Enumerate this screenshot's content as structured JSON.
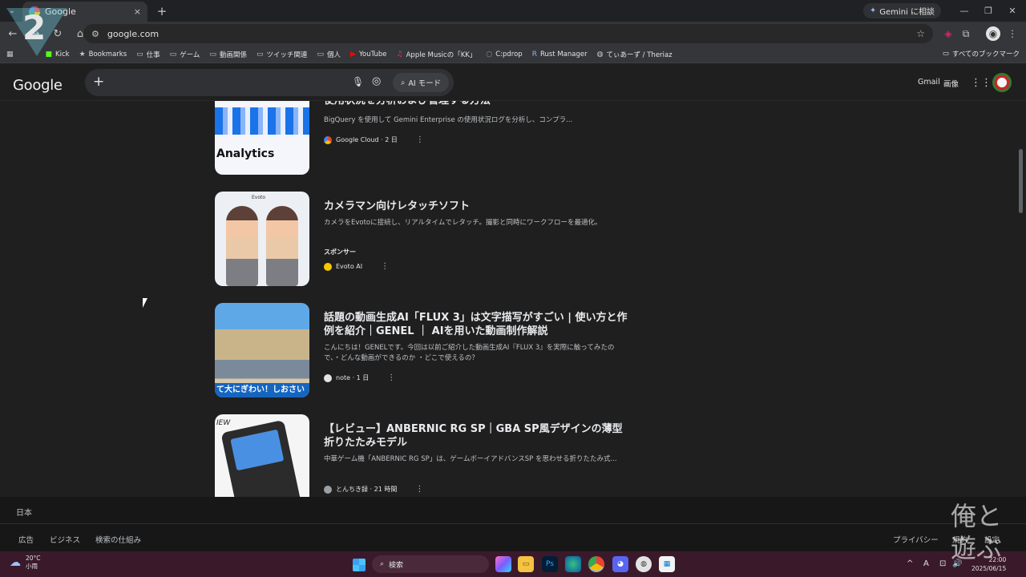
{
  "browser": {
    "tab_title": "Google",
    "tab_close": "×",
    "new_tab": "+",
    "gemini_label": "Gemini に相談",
    "url": "google.com",
    "bookmarks": [
      {
        "icon": "kick-icon",
        "label": "Kick"
      },
      {
        "icon": "star-icon",
        "label": "Bookmarks"
      },
      {
        "icon": "folder-icon",
        "label": "仕事"
      },
      {
        "icon": "folder-icon",
        "label": "ゲーム"
      },
      {
        "icon": "folder-icon",
        "label": "動画関係"
      },
      {
        "icon": "folder-icon",
        "label": "ツイッチ関連"
      },
      {
        "icon": "folder-icon",
        "label": "個人"
      },
      {
        "icon": "youtube-icon",
        "label": "YouTube"
      },
      {
        "icon": "apple-music-icon",
        "label": "Apple Musicの「KK」"
      },
      {
        "icon": "cpdrop-icon",
        "label": "C:pdrop"
      },
      {
        "icon": "rust-icon",
        "label": "Rust Manager"
      },
      {
        "icon": "globe-icon",
        "label": "てぃあーず / Theriaz"
      }
    ],
    "all_bookmarks": "すべてのブックマーク"
  },
  "google": {
    "logo": "Google",
    "ai_mode": "AI モード",
    "gmail": "Gmail",
    "images": "画像"
  },
  "feed": [
    {
      "title": "BigQuery を使用して Gemini Enterprise app の大規模な使用状況を分析および管理する方法",
      "snippet": "BigQuery を使用して Gemini Enterprise の使用状況ログを分析し、コンプラ...",
      "source": "Google Cloud · 2 日",
      "thumb_label": "Analytics"
    },
    {
      "title": "カメラマン向けレタッチソフト",
      "snippet": "カメラをEvotoに接続し、リアルタイムでレタッチ。撮影と同時にワークフローを最適化。",
      "sponsor": "スポンサー",
      "source": "Evoto AI",
      "thumb_label": "Evoto"
    },
    {
      "title": "話題の動画生成AI「FLUX 3」は文字描写がすごい | 使い方と作例を紹介｜GENEL ｜ AIを用いた動画制作解説",
      "snippet": "こんにちは！GENELです。今回は以前ご紹介した動画生成AI『FLUX 3』を実際に触ってみたので、・どんな動画ができるのか ・どこで使えるの？",
      "source": "note · 1 日",
      "thumb_label": "て大にぎわい！しおさい"
    },
    {
      "title": "【レビュー】ANBERNIC RG SP｜GBA SP風デザインの薄型折りたたみモデル",
      "snippet": "中華ゲーム機「ANBERNIC RG SP」は、ゲームボーイアドバンスSP を思わせる折りたたみ式...",
      "source": "とんちき録 · 21 時間",
      "thumb_label": "IEW"
    }
  ],
  "footer": {
    "country": "日本",
    "links_left": [
      "広告",
      "ビジネス",
      "検索の仕組み"
    ],
    "links_right": [
      "プライバシー",
      "規約",
      "設定"
    ]
  },
  "taskbar": {
    "temp": "20°C",
    "weather": "小雨",
    "search": "検索",
    "time": "22:00",
    "date": "2025/06/15"
  },
  "overlay": {
    "logo_number": "2",
    "corner_text": "俺と\n遊ぶ"
  },
  "colors": {
    "accent": "#8ab4f8",
    "background": "#1f1f1f",
    "taskbar": "#3a1a2a"
  }
}
